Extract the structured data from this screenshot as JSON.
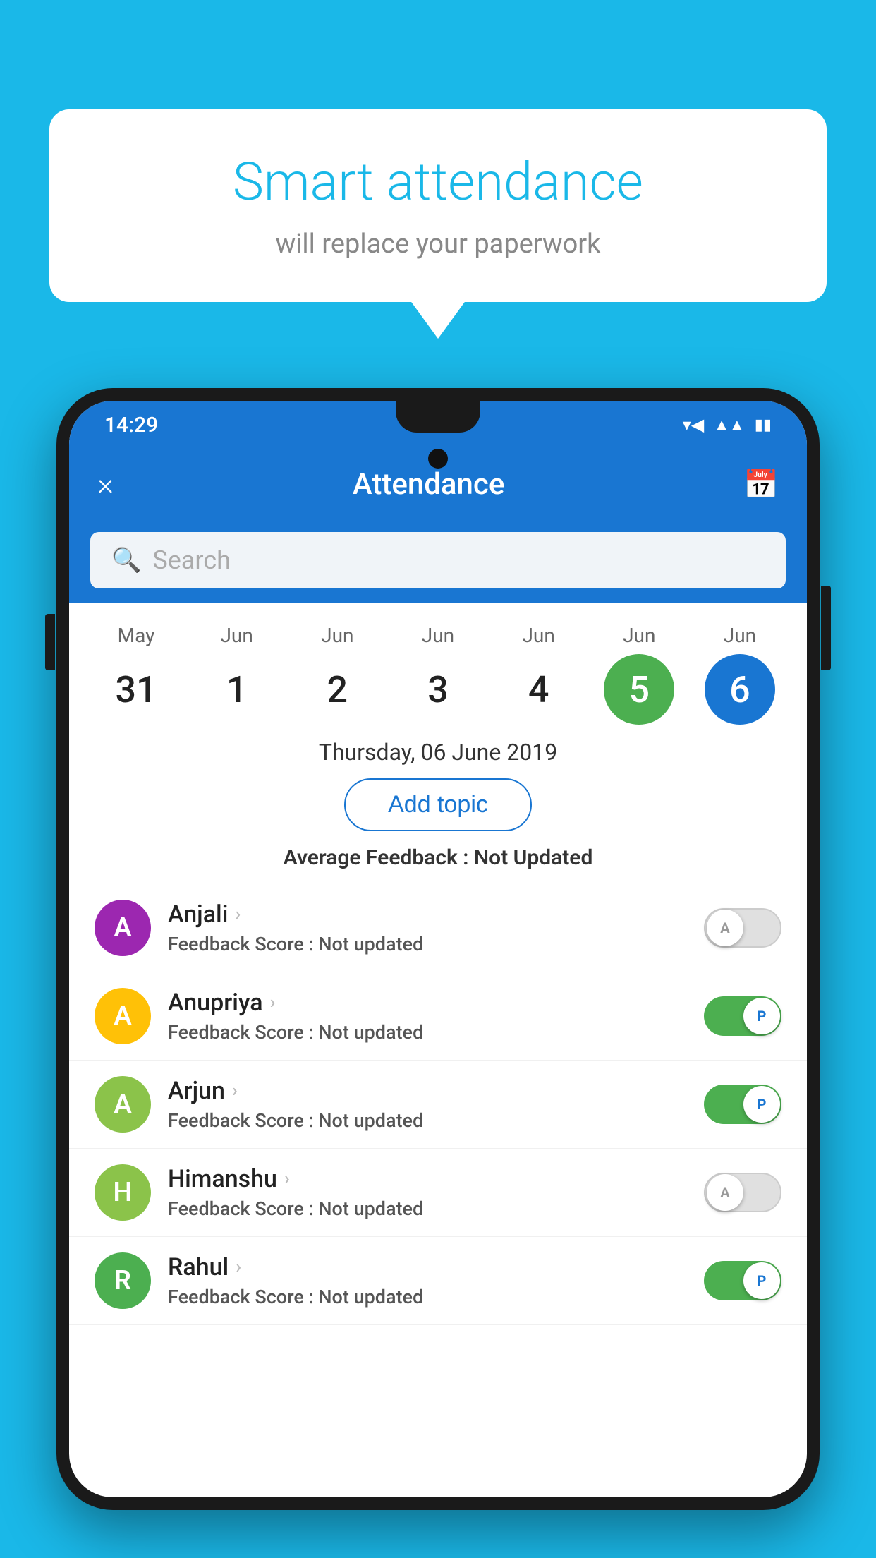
{
  "background": "#1AB8E8",
  "bubble": {
    "title": "Smart attendance",
    "subtitle": "will replace your paperwork"
  },
  "phone": {
    "status_time": "14:29",
    "app_bar": {
      "title": "Attendance",
      "close_label": "×",
      "calendar_icon": "calendar-icon"
    },
    "search": {
      "placeholder": "Search"
    },
    "calendar": {
      "days": [
        {
          "month": "May",
          "date": "31",
          "state": "normal"
        },
        {
          "month": "Jun",
          "date": "1",
          "state": "normal"
        },
        {
          "month": "Jun",
          "date": "2",
          "state": "normal"
        },
        {
          "month": "Jun",
          "date": "3",
          "state": "normal"
        },
        {
          "month": "Jun",
          "date": "4",
          "state": "normal"
        },
        {
          "month": "Jun",
          "date": "5",
          "state": "today"
        },
        {
          "month": "Jun",
          "date": "6",
          "state": "selected"
        }
      ]
    },
    "selected_date": "Thursday, 06 June 2019",
    "add_topic_label": "Add topic",
    "avg_feedback_label": "Average Feedback :",
    "avg_feedback_value": "Not Updated",
    "students": [
      {
        "name": "Anjali",
        "avatar_letter": "A",
        "avatar_color": "#9C27B0",
        "feedback_label": "Feedback Score :",
        "feedback_value": "Not updated",
        "toggle_state": "off",
        "toggle_letter": "A"
      },
      {
        "name": "Anupriya",
        "avatar_letter": "A",
        "avatar_color": "#FFC107",
        "feedback_label": "Feedback Score :",
        "feedback_value": "Not updated",
        "toggle_state": "on",
        "toggle_letter": "P"
      },
      {
        "name": "Arjun",
        "avatar_letter": "A",
        "avatar_color": "#8BC34A",
        "feedback_label": "Feedback Score :",
        "feedback_value": "Not updated",
        "toggle_state": "on",
        "toggle_letter": "P"
      },
      {
        "name": "Himanshu",
        "avatar_letter": "H",
        "avatar_color": "#8BC34A",
        "feedback_label": "Feedback Score :",
        "feedback_value": "Not updated",
        "toggle_state": "off",
        "toggle_letter": "A"
      },
      {
        "name": "Rahul",
        "avatar_letter": "R",
        "avatar_color": "#4CAF50",
        "feedback_label": "Feedback Score :",
        "feedback_value": "Not updated",
        "toggle_state": "on",
        "toggle_letter": "P"
      }
    ]
  }
}
